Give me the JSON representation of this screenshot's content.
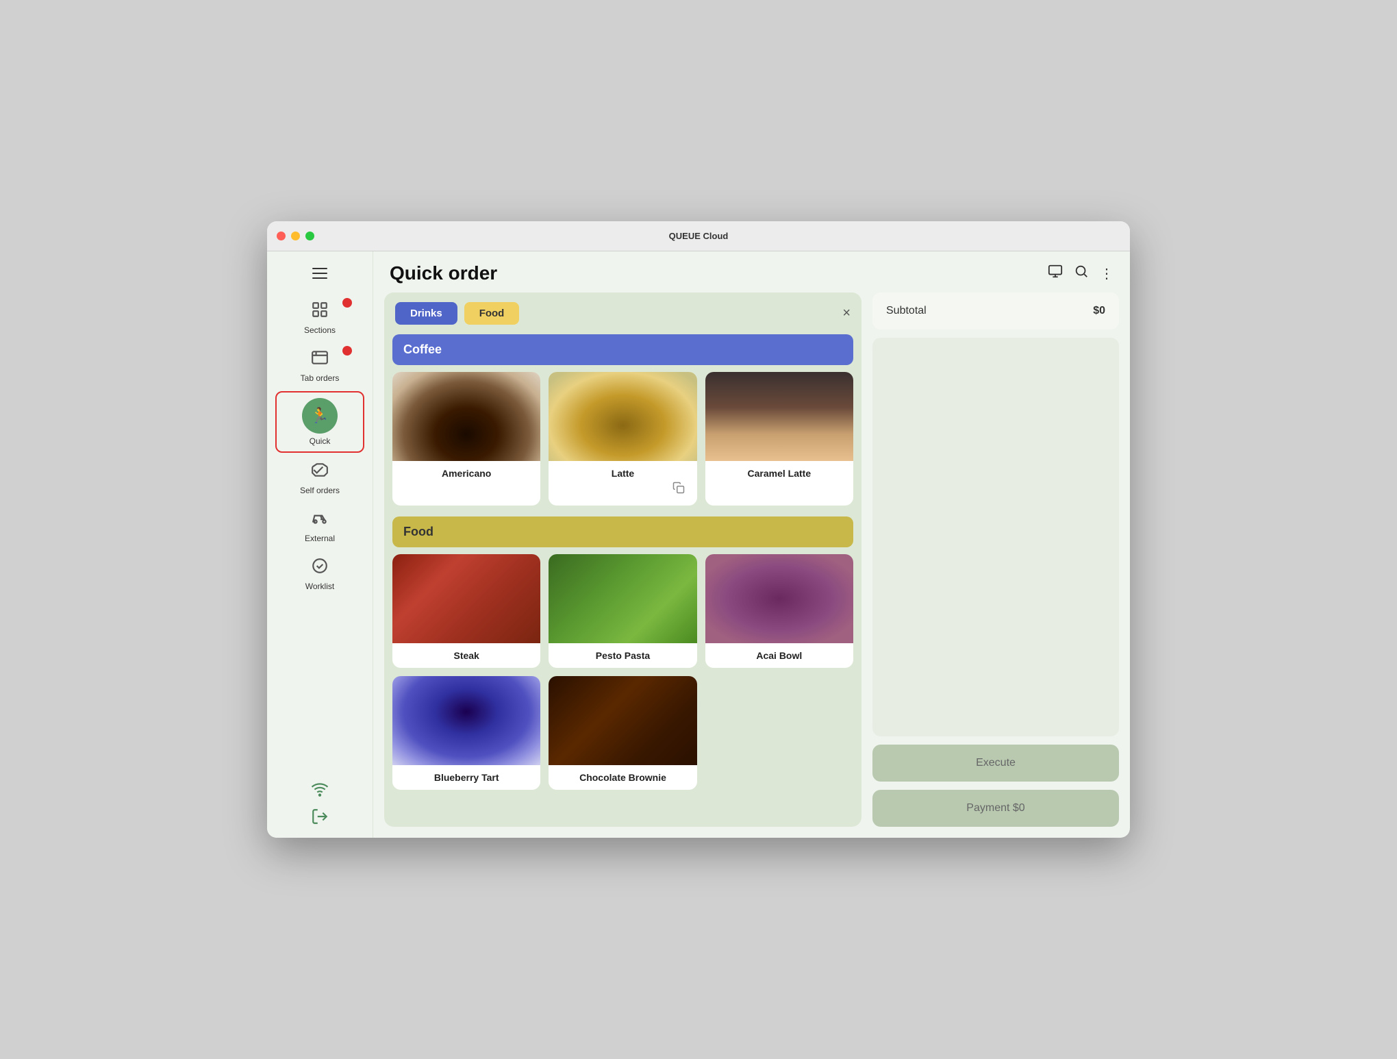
{
  "window": {
    "title": "QUEUE Cloud"
  },
  "sidebar": {
    "hamburger_label": "menu",
    "items": [
      {
        "id": "sections",
        "label": "Sections",
        "icon": "grid",
        "badge": true,
        "active": false
      },
      {
        "id": "tab-orders",
        "label": "Tab orders",
        "icon": "tab",
        "badge": true,
        "active": false
      },
      {
        "id": "quick",
        "label": "Quick",
        "icon": "run",
        "active": true
      },
      {
        "id": "self-orders",
        "label": "Self orders",
        "icon": "handshake",
        "active": false
      },
      {
        "id": "external",
        "label": "External",
        "icon": "scooter",
        "active": false
      },
      {
        "id": "worklist",
        "label": "Worklist",
        "icon": "check",
        "active": false
      }
    ],
    "bottom": [
      {
        "id": "wifi",
        "label": "wifi"
      },
      {
        "id": "logout",
        "label": "logout"
      }
    ]
  },
  "header": {
    "title": "Quick order",
    "actions": [
      "monitor",
      "search",
      "more"
    ]
  },
  "filters": {
    "tabs": [
      {
        "id": "drinks",
        "label": "Drinks",
        "active": true
      },
      {
        "id": "food",
        "label": "Food",
        "active": false
      }
    ],
    "close_label": "×"
  },
  "categories": [
    {
      "id": "coffee",
      "label": "Coffee",
      "type": "coffee",
      "products": [
        {
          "id": "americano",
          "name": "Americano",
          "img_class": "img-americano"
        },
        {
          "id": "latte",
          "name": "Latte",
          "img_class": "img-latte",
          "has_copy": true
        },
        {
          "id": "caramel-latte",
          "name": "Caramel Latte",
          "img_class": "img-caramel-latte"
        }
      ]
    },
    {
      "id": "food",
      "label": "Food",
      "type": "food",
      "products": [
        {
          "id": "steak",
          "name": "Steak",
          "img_class": "img-steak"
        },
        {
          "id": "pesto-pasta",
          "name": "Pesto Pasta",
          "img_class": "img-pesto-pasta"
        },
        {
          "id": "acai-bowl",
          "name": "Acai Bowl",
          "img_class": "img-acai-bowl"
        },
        {
          "id": "blueberry-tart",
          "name": "Blueberry Tart",
          "img_class": "img-blueberry-tart"
        },
        {
          "id": "chocolate-brownie",
          "name": "Chocolate Brownie",
          "img_class": "img-chocolate-brownie"
        }
      ]
    }
  ],
  "order": {
    "subtotal_label": "Subtotal",
    "subtotal_value": "$0",
    "execute_label": "Execute",
    "payment_label": "Payment $0"
  }
}
